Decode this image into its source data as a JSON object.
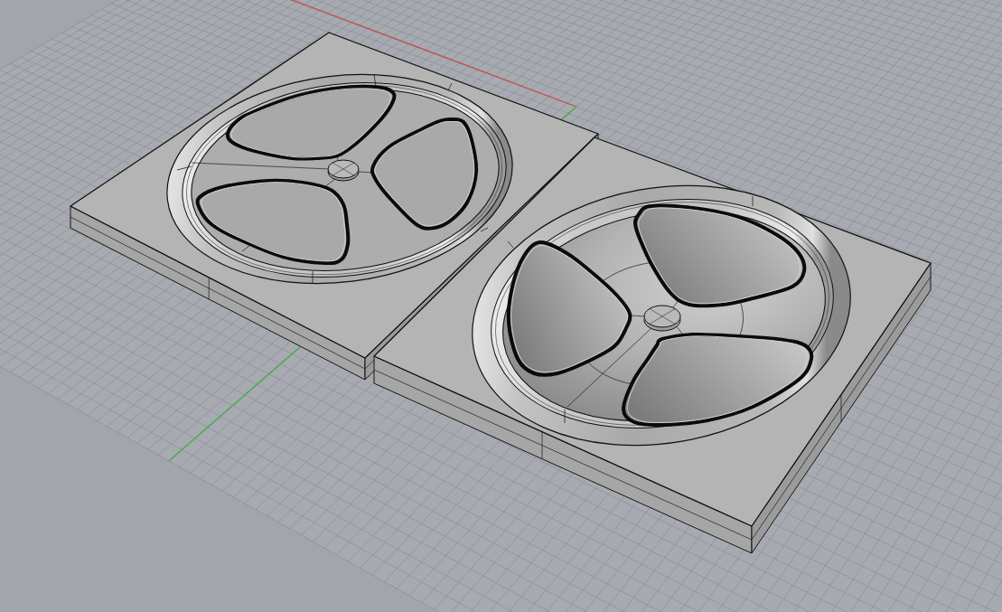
{
  "viewport": {
    "axes": [
      {
        "kind": "x",
        "color": "#c2514c"
      },
      {
        "kind": "y",
        "color": "#46a846"
      }
    ],
    "parts": [
      {
        "kind": "flat"
      },
      {
        "kind": "dish"
      }
    ]
  }
}
